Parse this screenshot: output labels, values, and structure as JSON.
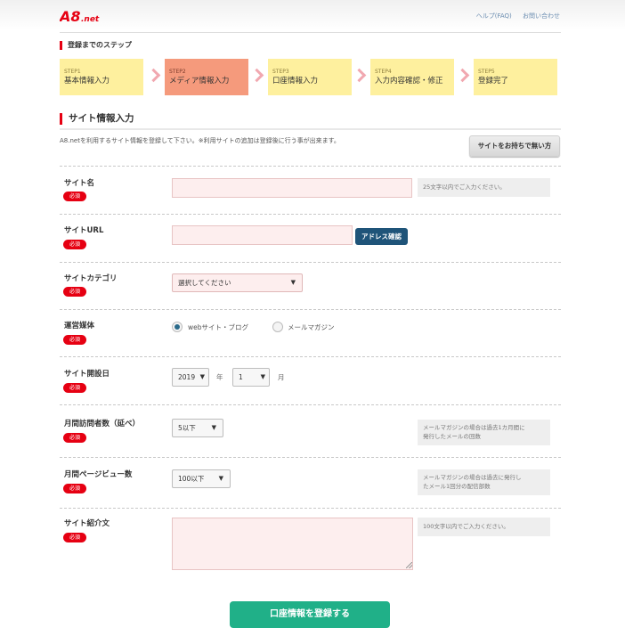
{
  "header": {
    "logo_text": "A8.net",
    "help_link": "ヘルプ(FAQ)",
    "contact_link": "お問い合わせ"
  },
  "steps": {
    "title": "登録までのステップ",
    "items": [
      {
        "num": "STEP1",
        "label": "基本情報入力"
      },
      {
        "num": "STEP2",
        "label": "メディア情報入力",
        "active": true
      },
      {
        "num": "STEP3",
        "label": "口座情報入力"
      },
      {
        "num": "STEP4",
        "label": "入力内容確認・修正"
      },
      {
        "num": "STEP5",
        "label": "登録完了"
      }
    ]
  },
  "section": {
    "title": "サイト情報入力",
    "description": "A8.netを利用するサイト情報を登録して下さい。※利用サイトの追加は登録後に行う事が出来ます。",
    "no_site_button": "サイトをお持ちで無い方"
  },
  "required_badge": "必須",
  "form": {
    "site_name": {
      "label": "サイト名",
      "value": "",
      "hint": "25文字以内でご入力ください。"
    },
    "site_url": {
      "label": "サイトURL",
      "value": "",
      "button": "アドレス確認"
    },
    "site_category": {
      "label": "サイトカテゴリ",
      "selected": "選択してください"
    },
    "media": {
      "label": "運営媒体",
      "options": [
        "webサイト・ブログ",
        "メールマガジン"
      ],
      "selected": "webサイト・ブログ"
    },
    "opened": {
      "label": "サイト開設日",
      "year": "2019",
      "year_unit": "年",
      "month": "1",
      "month_unit": "月"
    },
    "visitors": {
      "label": "月間訪問者数（延べ）",
      "selected": "5以下",
      "hint_line1": "メールマガジンの場合は過去1カ月間に",
      "hint_line2": "発行したメールの回数"
    },
    "pageviews": {
      "label": "月間ページビュー数",
      "selected": "100以下",
      "hint_line1": "メールマガジンの場合は過去に発行し",
      "hint_line2": "たメール1回分の配信部数"
    },
    "intro": {
      "label": "サイト紹介文",
      "value": "",
      "hint": "100文字以内でご入力ください。"
    }
  },
  "submit_button": "口座情報を登録する",
  "colors": {
    "brand_red": "#e60012",
    "step_bg": "#fef09e",
    "step_active_bg": "#f59a7c",
    "input_bg": "#fdeeee",
    "submit_bg": "#20b088",
    "address_button_bg": "#1f5479"
  }
}
